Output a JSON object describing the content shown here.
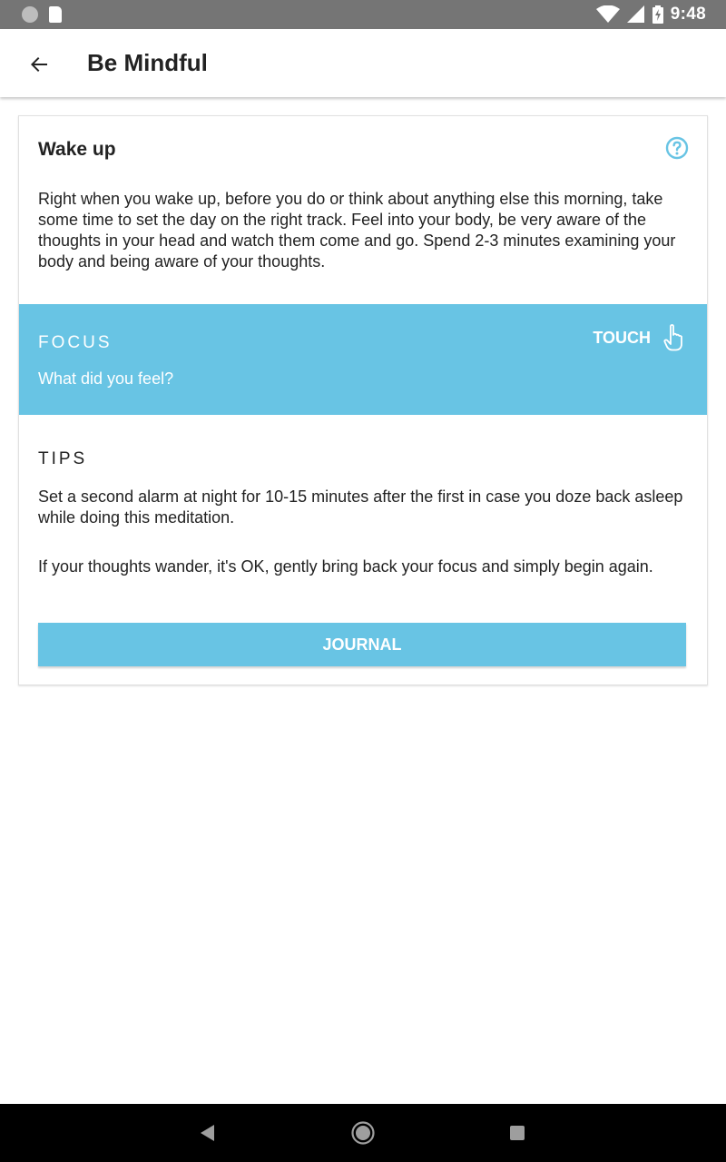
{
  "status_bar": {
    "time": "9:48",
    "icons": [
      "notification-dot-icon",
      "sd-card-icon",
      "wifi-icon",
      "signal-icon",
      "battery-charging-icon"
    ]
  },
  "app_bar": {
    "title": "Be Mindful",
    "back_icon": "arrow-left-icon"
  },
  "card": {
    "title": "Wake up",
    "help_icon": "help-circle-icon",
    "description": "Right when you wake up, before you do or think about anything else this morning, take some time to set the day on the right track. Feel into your body, be very aware of the thoughts in your head and watch them come and go. Spend 2-3 minutes examining your body and being aware of your thoughts.",
    "focus": {
      "heading": "FOCUS",
      "question": "What did you feel?",
      "touch_label": "TOUCH",
      "touch_icon": "hand-pointer-icon"
    },
    "tips": {
      "heading": "TIPS",
      "items": [
        "Set a second alarm at night for 10-15 minutes after the first in case you doze back asleep while doing this meditation.",
        "If your thoughts wander, it's OK, gently bring back your focus and simply begin again."
      ]
    },
    "journal_label": "JOURNAL"
  },
  "nav_bar": {
    "icons": [
      "nav-back-icon",
      "nav-home-icon",
      "nav-recents-icon"
    ]
  },
  "colors": {
    "accent": "#68c4e4",
    "status_bar": "#757575",
    "text": "#222222"
  }
}
